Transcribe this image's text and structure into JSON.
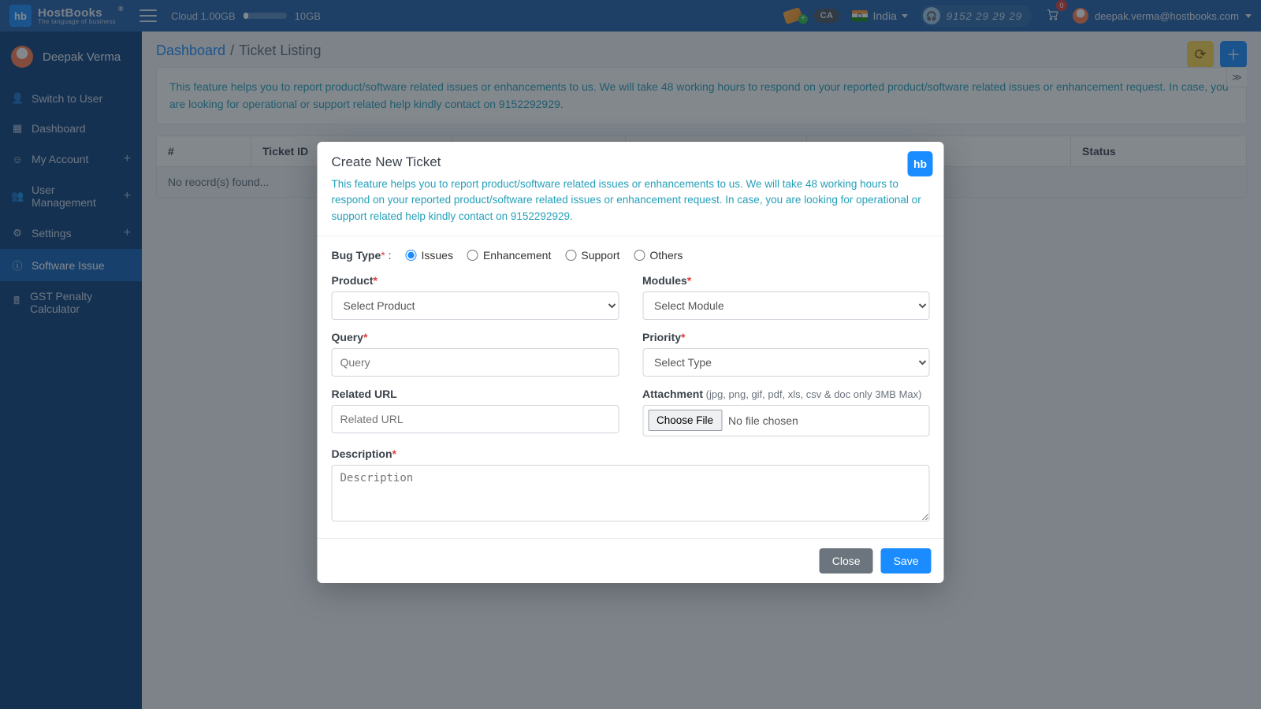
{
  "brand": {
    "badge": "hb",
    "name": "HostBooks",
    "tag": "The language of business"
  },
  "top": {
    "cloud_used": "Cloud 1.00GB",
    "cloud_cap": "10GB",
    "ca_badge": "CA",
    "country": "India",
    "phone": "9152 29 29 29",
    "cart_count": "0",
    "user_email": "deepak.verma@hostbooks.com"
  },
  "sidebar": {
    "user": "Deepak Verma",
    "items": [
      {
        "label": "Switch to User",
        "icon": "👤",
        "plus": false
      },
      {
        "label": "Dashboard",
        "icon": "▦",
        "plus": false
      },
      {
        "label": "My Account",
        "icon": "☺",
        "plus": true
      },
      {
        "label": "User Management",
        "icon": "👥",
        "plus": true
      },
      {
        "label": "Settings",
        "icon": "⚙",
        "plus": true
      },
      {
        "label": "Software Issue",
        "icon": "ⓘ",
        "plus": false,
        "active": true
      },
      {
        "label": "GST Penalty Calculator",
        "icon": "🖩",
        "plus": false
      }
    ]
  },
  "crumbs": {
    "root": "Dashboard",
    "sep": "/",
    "leaf": "Ticket Listing"
  },
  "banner": "This feature helps you to report product/software related issues or enhancements to us. We will take 48 working hours to respond on your reported product/software related issues or enhancement request. In case, you are looking for operational or support related help kindly contact on 9152292929.",
  "table": {
    "cols": [
      "#",
      "Ticket ID",
      "",
      "",
      "",
      "Status"
    ],
    "empty": "No reocrd(s) found..."
  },
  "modal": {
    "title": "Create New Ticket",
    "note": "This feature helps you to report product/software related issues or enhancements to us. We will take 48 working hours to respond on your reported product/software related issues or enhancement request. In case, you are looking for operational or support related help kindly contact on 9152292929.",
    "bug_label": "Bug Type",
    "bug_colon": " :",
    "bug_opts": [
      "Issues",
      "Enhancement",
      "Support",
      "Others"
    ],
    "product_label": "Product",
    "product_placeholder": "Select Product",
    "modules_label": "Modules",
    "modules_placeholder": "Select Module",
    "query_label": "Query",
    "query_placeholder": "Query",
    "priority_label": "Priority",
    "priority_placeholder": "Select Type",
    "relurl_label": "Related URL",
    "relurl_placeholder": "Related URL",
    "attach_label": "Attachment",
    "attach_hint": " (jpg, png, gif, pdf, xls, csv & doc only 3MB Max)",
    "file_btn": "Choose File",
    "file_none": "No file chosen",
    "desc_label": "Description",
    "desc_placeholder": "Description",
    "close": "Close",
    "save": "Save"
  }
}
